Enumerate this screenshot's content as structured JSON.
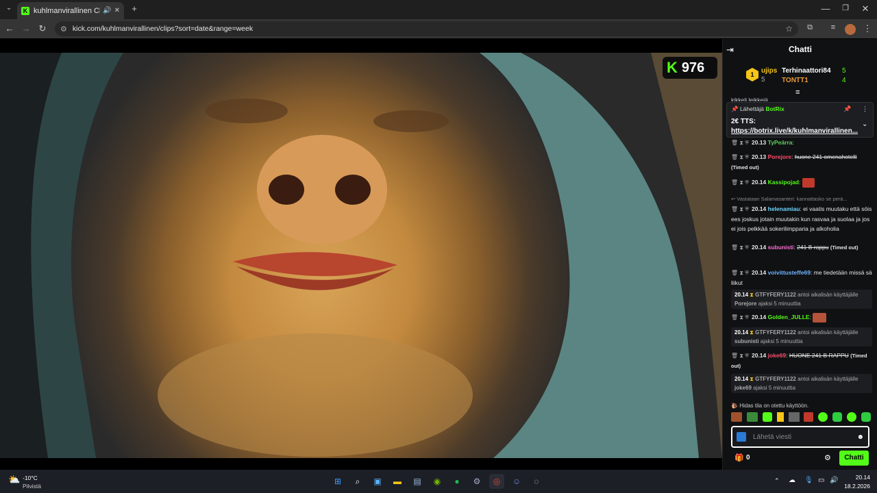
{
  "browser": {
    "tab_title": "kuhlmanvirallinen Clips - W",
    "url": "kick.com/kuhlmanvirallinen/clips?sort=date&range=week"
  },
  "stream": {
    "viewer_count": "976",
    "accent_color": "#53fc18"
  },
  "chat": {
    "title": "Chatti",
    "leaderboard": {
      "first_name": "ujips",
      "first_count": "5",
      "second_name": "Terhinaattori84",
      "second_count": "5",
      "third_name": "TONTT1",
      "third_count": "4"
    },
    "partial_top": "kikkeli leikkeiä",
    "pinned": {
      "by_label": "Lähettäjä",
      "by_user": "BotRix",
      "line1": "2€ TTS:",
      "line2": "https://botrix.live/k/kuhlmanvirallinen..."
    },
    "messages": [
      {
        "time": "20.13",
        "user": "TyPeärra",
        "text": ":"
      },
      {
        "time": "20.13",
        "user": "Porejore",
        "text": "huone 241 omenahotelli",
        "note": "(Timed out)"
      },
      {
        "time": "20.14",
        "user": "Kassipojad",
        "text": ":"
      },
      {
        "reply": "Vastataan Salamasanteri: kannattasko se perä...",
        "time": "20.14",
        "user": "helenamiau",
        "text": "ei vaatis muutaku että söis ees joskus jotain muutakin kun rasvaa ja suolaa ja jos ei jois pelkkää sokerilimpparia ja alkoholia"
      },
      {
        "time": "20.14",
        "user": "subunisti",
        "text": "241 B rappu",
        "note": "(Timed out)"
      },
      {
        "time": "20.14",
        "user": "voivittusteffe69",
        "text": "me tiedetään missä sä liikut"
      },
      {
        "system": true,
        "time": "20.14",
        "user": "GTFYFERY1122",
        "text": "antoi aikalisän käyttäjälle",
        "target": "Porejore",
        "duration": "ajaksi 5 minuuttia"
      },
      {
        "time": "20.14",
        "user": "Golden_JULLE",
        "text": ":"
      },
      {
        "system": true,
        "time": "20.14",
        "user": "GTFYFERY1122",
        "text": "antoi aikalisän käyttäjälle",
        "target": "subunisti",
        "duration": "ajaksi 5 minuuttia"
      },
      {
        "time": "20.14",
        "user": "joke69",
        "text": "HUONE 241 B RAPPU",
        "note": "(Timed out)"
      },
      {
        "system": true,
        "time": "20.14",
        "user": "GTFYFERY1122",
        "text": "antoi aikalisän käyttäjälle",
        "target": "joke69",
        "duration": "ajaksi 5 minuuttia"
      }
    ],
    "slow_mode": "Hidas tila on otettu käyttöön.",
    "input_placeholder": "Lähetä viesti",
    "points": "0",
    "send_label": "Chatti",
    "user_colors": {
      "TyPeärra": "#5ed15e",
      "Porejore": "#ff4d6d",
      "Kassipojad": "#53fc18",
      "helenamiau": "#6fd6ff",
      "subunisti": "#ff6bd6",
      "voivittusteffe69": "#6fb4ff",
      "Golden_JULLE": "#53fc18",
      "joke69": "#ff4d6d"
    }
  },
  "taskbar": {
    "weather_temp": "-10°C",
    "weather_desc": "Pilvistä",
    "time": "20.14",
    "date": "18.2.2026"
  }
}
